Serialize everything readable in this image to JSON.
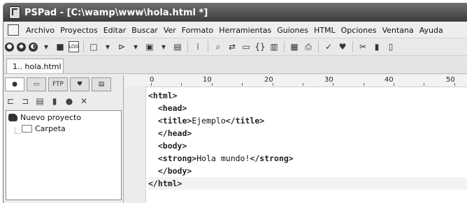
{
  "window": {
    "title": "PSPad - [C:\\wamp\\www\\hola.html *]"
  },
  "menu": {
    "items": [
      "Archivo",
      "Proyectos",
      "Editar",
      "Buscar",
      "Ver",
      "Formato",
      "Herramientas",
      "Guiones",
      "HTML",
      "Opciones",
      "Ventana",
      "Ayuda"
    ]
  },
  "toolbar": {
    "icons": [
      "open-project-icon",
      "new-project-icon",
      "recent-projects-icon",
      "settings-icon",
      "log-icon",
      "new-file-icon",
      "open-file-icon",
      "save-icon",
      "save-all-icon",
      "cut-bookmark-icon",
      "find-icon",
      "replace-icon",
      "preview-icon",
      "code-icon",
      "book-icon",
      "template-icon",
      "print-icon",
      "check-icon",
      "favorite-icon",
      "scissors-icon",
      "copy-icon",
      "paste-icon"
    ]
  },
  "tabs": {
    "document": "1.. hola.html"
  },
  "left_panel": {
    "tree": {
      "project": "Nuevo proyecto",
      "folder": "Carpeta"
    }
  },
  "editor": {
    "ruler": [
      "0",
      "10",
      "20",
      "30",
      "40",
      "50"
    ],
    "lines": [
      {
        "tag1": "<html>",
        "text": "",
        "tag2": "",
        "indent": ""
      },
      {
        "tag1": "<head>",
        "text": "",
        "tag2": "",
        "indent": "  "
      },
      {
        "tag1": "<title>",
        "text": "Ejemplo",
        "tag2": "</title>",
        "indent": "  "
      },
      {
        "tag1": "</head>",
        "text": "",
        "tag2": "",
        "indent": "  "
      },
      {
        "tag1": "<body>",
        "text": "",
        "tag2": "",
        "indent": "  "
      },
      {
        "tag1": "<strong>",
        "text": "Hola mundo!",
        "tag2": "</strong>",
        "indent": "  "
      },
      {
        "tag1": "</body>",
        "text": "",
        "tag2": "",
        "indent": "  "
      },
      {
        "tag1": "</html>",
        "text": "",
        "tag2": "",
        "indent": ""
      }
    ]
  }
}
